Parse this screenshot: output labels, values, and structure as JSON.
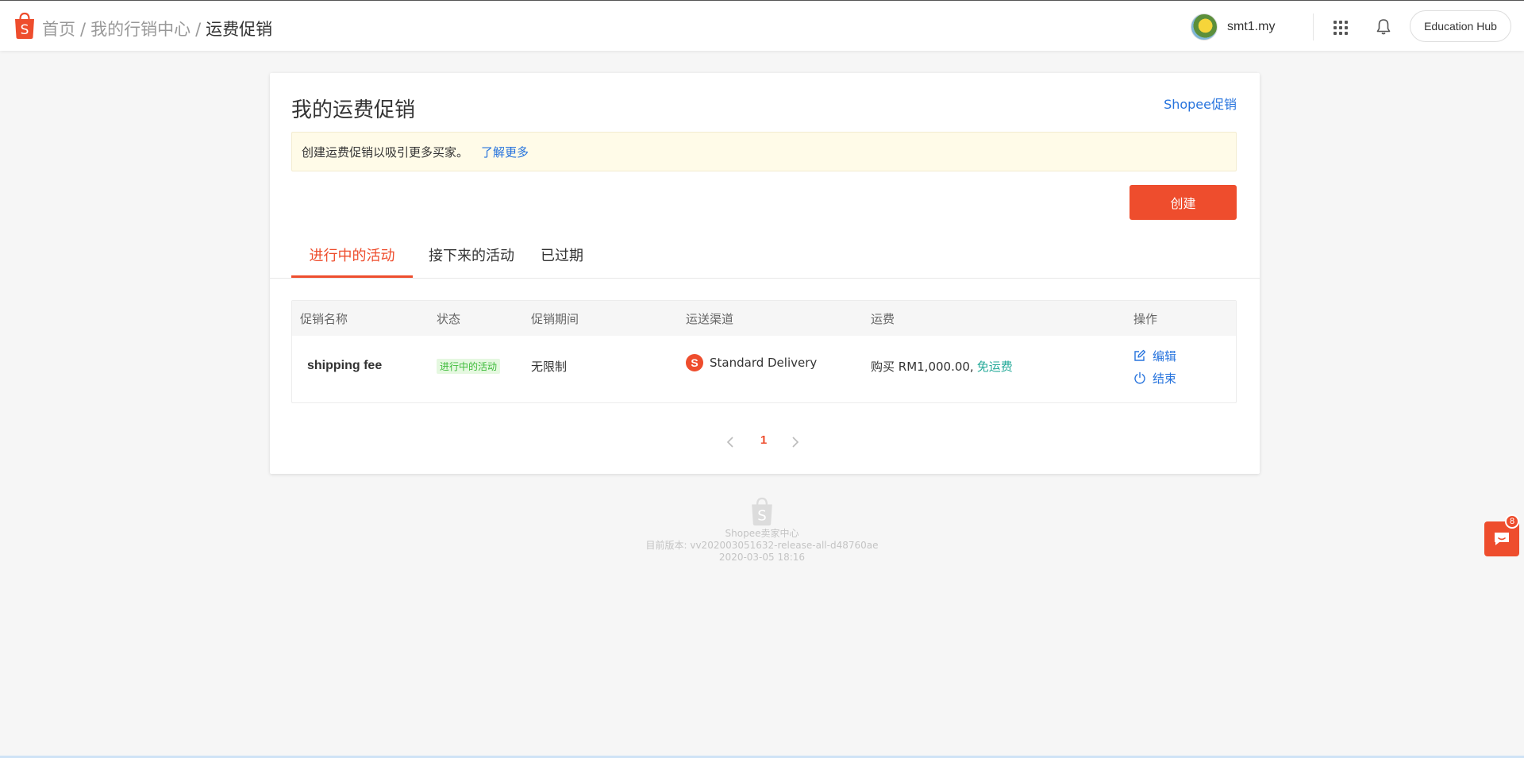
{
  "header": {
    "breadcrumb": [
      "首页",
      "我的行销中心",
      "运费促销"
    ],
    "username": "smt1.my",
    "education_hub": "Education Hub"
  },
  "page": {
    "title": "我的运费促销",
    "shopee_promo_link": "Shopee促销",
    "notice_text": "创建运费促销以吸引更多买家。",
    "notice_link": "了解更多",
    "create_button": "创建"
  },
  "tabs": [
    {
      "label": "进行中的活动",
      "active": true
    },
    {
      "label": "接下来的活动",
      "active": false
    },
    {
      "label": "已过期",
      "active": false
    }
  ],
  "table": {
    "headers": [
      "促销名称",
      "状态",
      "促销期间",
      "运送渠道",
      "运费",
      "操作"
    ],
    "rows": [
      {
        "name": "shipping fee",
        "status": "进行中的活动",
        "period": "无限制",
        "channel_icon": "S",
        "channel": "Standard Delivery",
        "fee_prefix": "购买 RM1,000.00,",
        "fee_free": "免运费",
        "action_edit": "编辑",
        "action_end": "结束"
      }
    ]
  },
  "pagination": {
    "current": "1"
  },
  "footer": {
    "name": "Shopee卖家中心",
    "version": "目前版本: vv202003051632-release-all-d48760ae",
    "date": "2020-03-05 18:16"
  },
  "chat": {
    "badge": "8"
  },
  "colors": {
    "brand": "#ee4d2d",
    "link": "#2673dd",
    "success": "#26aa99"
  }
}
